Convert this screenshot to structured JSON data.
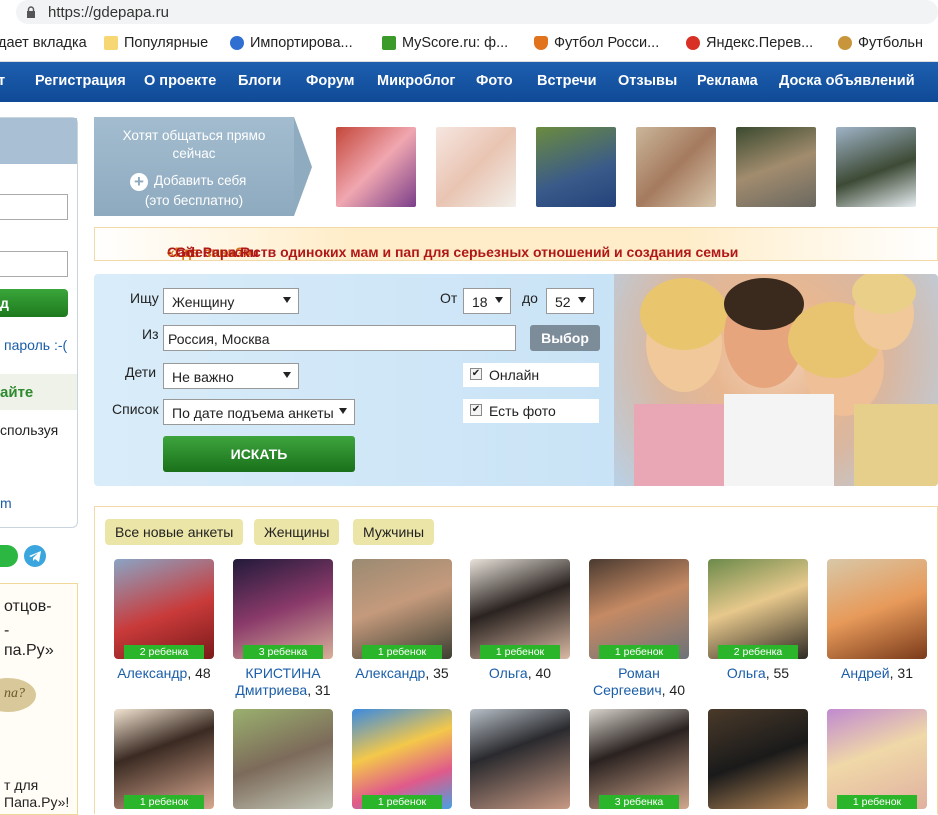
{
  "browser": {
    "url": "https://gdepapa.ru",
    "bookmarks": [
      "дает вкладка",
      "Популярные",
      "Импортирова...",
      "MyScore.ru: ф...",
      "Футбол Росси...",
      "Яндекс.Перев...",
      "Футбольн"
    ]
  },
  "nav": {
    "items": [
      "т",
      "Регистрация",
      "О проекте",
      "Блоги",
      "Форум",
      "Микроблог",
      "Фото",
      "Встречи",
      "Отзывы",
      "Реклама",
      "Доска объявлений"
    ]
  },
  "left": {
    "login_btn": "д",
    "forgot": "пароль :-(",
    "enter_label": "айте",
    "using": "спользуя",
    "m_text": "m",
    "ad_l1": "отцов-",
    "ad_l2": "-",
    "ad_l3": "па.Ру»",
    "ad_logo": "па?",
    "ad_bottom1": "т для",
    "ad_bottom2": "Папа.Ру»!"
  },
  "online": {
    "line1": "Хотят общаться прямо",
    "line2": "сейчас",
    "add": "Добавить себя",
    "free": "(это бесплатно)"
  },
  "slogan": {
    "prefix": "Сайт знакомств одиноких мам и пап для серьезных отношений и создания семьи ",
    "quote": "«Где папа?»",
    "suffix": " - GdePapa.Ru"
  },
  "search": {
    "seek_label": "Ищу",
    "seek_value": "Женщину",
    "from_label": "От",
    "from_value": "18",
    "to_label": "до",
    "to_value": "52",
    "city_label": "Из",
    "city_value": "Россия, Москва",
    "choose_btn": "Выбор",
    "kids_label": "Дети",
    "kids_value": "Не важно",
    "online_chk": "Онлайн",
    "list_label": "Список",
    "list_value": "По дате подъема анкеты",
    "photo_chk": "Есть фото",
    "search_btn": "ИСКАТЬ"
  },
  "tabs": [
    "Все новые анкеты",
    "Женщины",
    "Мужчины"
  ],
  "profiles_row1": [
    {
      "badge": "2 ребенка",
      "name": "Александр",
      "age": ", 48",
      "name2": ""
    },
    {
      "badge": "3 ребенка",
      "name": "КРИСТИНА",
      "age": ", 31",
      "name2": "Дмитриева"
    },
    {
      "badge": "1 ребенок",
      "name": "Александр",
      "age": ", 35",
      "name2": ""
    },
    {
      "badge": "1 ребенок",
      "name": "Ольга",
      "age": ", 40",
      "name2": ""
    },
    {
      "badge": "1 ребенок",
      "name": "Роман",
      "age": ", 40",
      "name2": "Сергеевич"
    },
    {
      "badge": "2 ребенка",
      "name": "Ольга",
      "age": ", 55",
      "name2": ""
    },
    {
      "badge": "",
      "name": "Андрей",
      "age": ", 31",
      "name2": ""
    }
  ],
  "profiles_row2_badges": [
    "1 ребенок",
    "",
    "1 ребенок",
    "",
    "3 ребенка",
    "",
    "1 ребенок"
  ],
  "colors": {
    "nav": "#1a5aa9",
    "accent_green": "#2ab52a",
    "slogan_red": "#b01818",
    "link_blue": "#1a5ea8"
  }
}
